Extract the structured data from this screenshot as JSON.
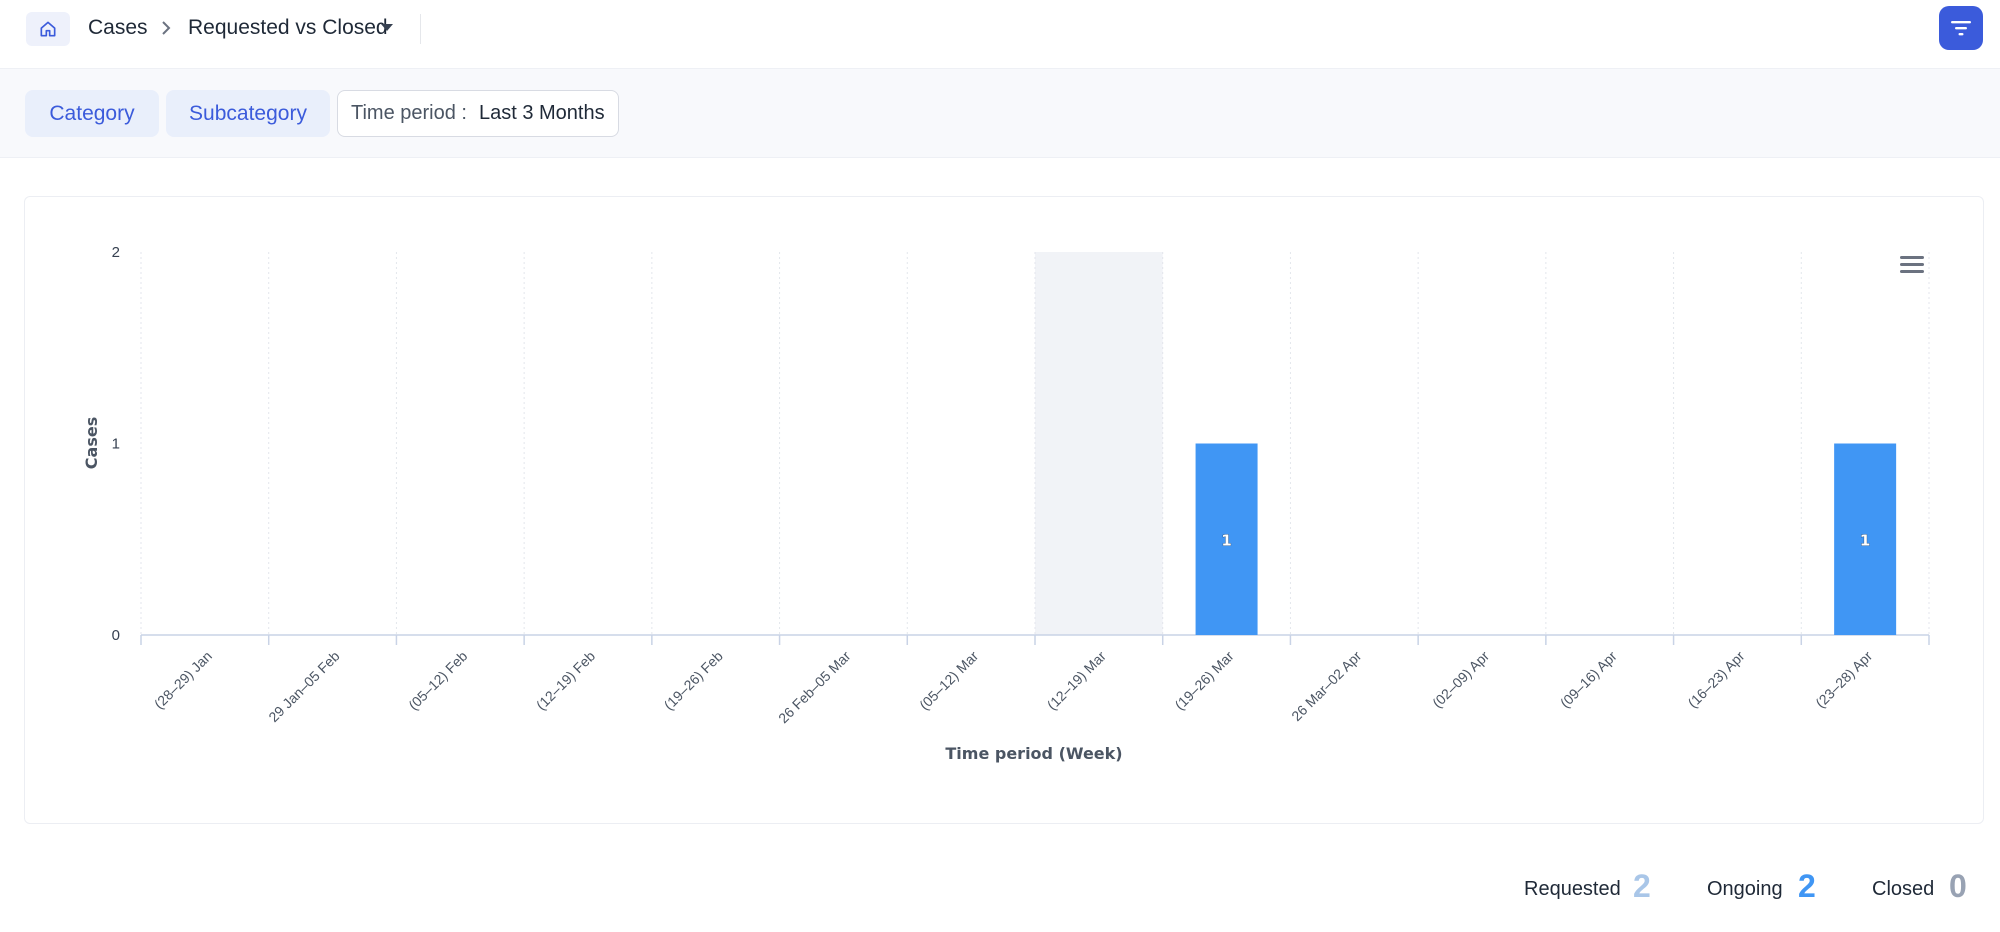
{
  "header": {
    "breadcrumb_root": "Cases",
    "breadcrumb_current": "Requested vs Closed",
    "accent": "#3b5bdb"
  },
  "filters": {
    "category_label": "Category",
    "subcategory_label": "Subcategory",
    "time_period_label": "Time period :",
    "time_period_value": "Last 3 Months"
  },
  "chart_data": {
    "type": "bar",
    "xlabel": "Time period (Week)",
    "ylabel": "Cases",
    "ylim": [
      0,
      2
    ],
    "yticks": [
      0,
      1,
      2
    ],
    "grid": true,
    "categories": [
      "(28–29) Jan",
      "29 Jan–05 Feb",
      "(05–12) Feb",
      "(12–19) Feb",
      "(19–26) Feb",
      "26 Feb–05 Mar",
      "(05–12) Mar",
      "(12–19) Mar",
      "(19–26) Mar",
      "26 Mar–02 Apr",
      "(02–09) Apr",
      "(09–16) Apr",
      "(16–23) Apr",
      "(23–28) Apr"
    ],
    "series": [
      {
        "values": [
          0,
          0,
          0,
          0,
          0,
          0,
          0,
          0,
          1,
          0,
          0,
          0,
          0,
          1
        ],
        "color": "#4096f4"
      }
    ],
    "highlighted_category_index": 7
  },
  "stats": [
    {
      "label": "Requested",
      "value": "2",
      "color": "#a9c6e8"
    },
    {
      "label": "Ongoing",
      "value": "2",
      "color": "#4096f4"
    },
    {
      "label": "Closed",
      "value": "0",
      "color": "#98a2b3"
    }
  ]
}
